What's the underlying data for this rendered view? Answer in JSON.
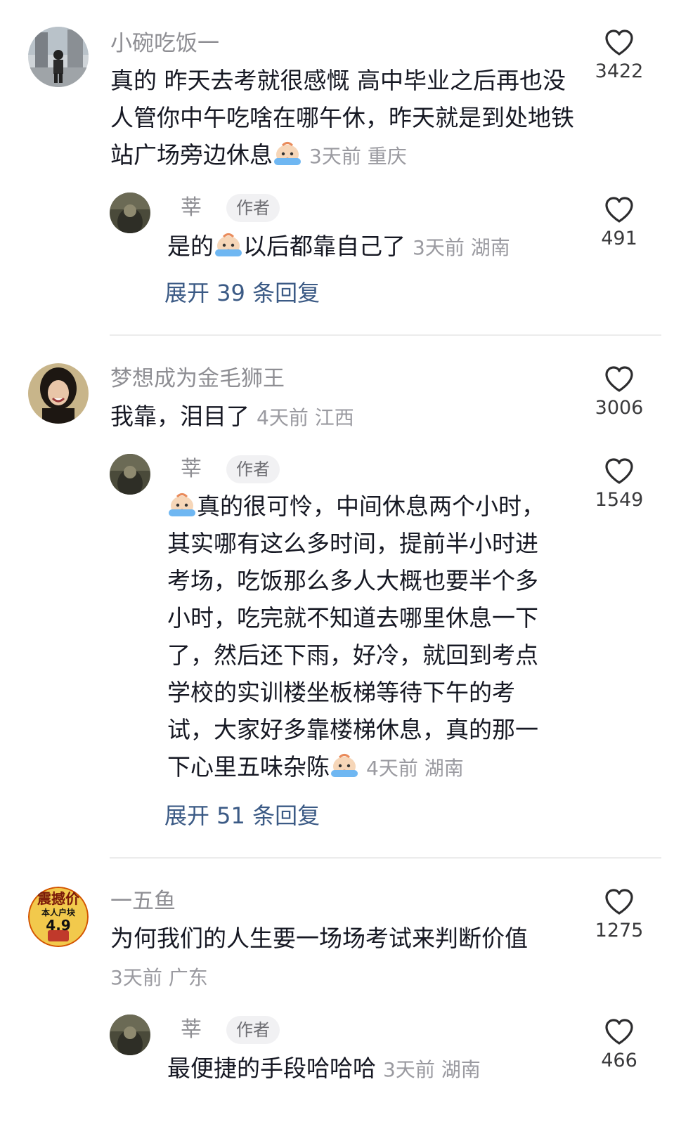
{
  "comments": [
    {
      "username": "小碗吃饭一",
      "text": "真的 昨天去考就很感慨 高中毕业之后再也没人管你中午吃啥在哪午休，昨天就是到处地铁站广场旁边休息",
      "time_location": "3天前 重庆",
      "likes": "3422",
      "reply": {
        "username": "莘",
        "badge": "作者",
        "text_before": "是的",
        "text_after": "以后都靠自己了",
        "time_location": "3天前 湖南",
        "likes": "491"
      },
      "expand_label": "展开 39 条回复"
    },
    {
      "username": "梦想成为金毛狮王",
      "text": "我靠，泪目了",
      "time_location": "4天前 江西",
      "likes": "3006",
      "reply": {
        "username": "莘",
        "badge": "作者",
        "text": "真的很可怜，中间休息两个小时，其实哪有这么多时间，提前半小时进考场，吃饭那么多人大概也要半个多小时，吃完就不知道去哪里休息一下了，然后还下雨，好冷，就回到考点学校的实训楼坐板梯等待下午的考试，大家好多靠楼梯休息，真的那一下心里五味杂陈",
        "time_location": "4天前 湖南",
        "likes": "1549"
      },
      "expand_label": "展开 51 条回复"
    },
    {
      "username": "一五鱼",
      "avatar_text": [
        "震撼价",
        "本人户块",
        "4.9"
      ],
      "text": "为何我们的人生要一场场考试来判断价值",
      "time_location": "3天前 广东",
      "likes": "1275",
      "reply": {
        "username": "莘",
        "badge": "作者",
        "text": "最便捷的手段哈哈哈",
        "time_location": "3天前 湖南",
        "likes": "466"
      }
    }
  ],
  "icons": {
    "like": "heart-outline-icon",
    "emoji": "crying-emoji-icon"
  },
  "colors": {
    "text": "#161823",
    "meta": "#9a9aa0",
    "link": "#3b5a85"
  }
}
